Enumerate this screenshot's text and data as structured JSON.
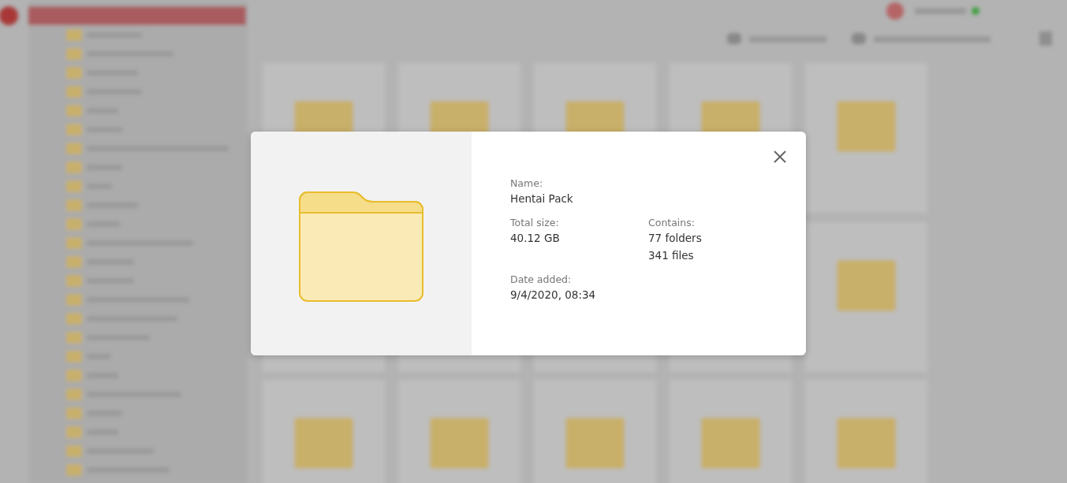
{
  "dialog": {
    "kind": "folder",
    "fields": [
      {
        "label": "Name:",
        "values": [
          "Hentai Pack"
        ]
      },
      {
        "label": "Total size:",
        "values": [
          "40.12 GB"
        ]
      },
      {
        "label": "Contains:",
        "values": [
          "77 folders",
          "341 files"
        ]
      },
      {
        "label": "Date added:",
        "values": [
          "9/4/2020, 08:34"
        ]
      }
    ]
  }
}
